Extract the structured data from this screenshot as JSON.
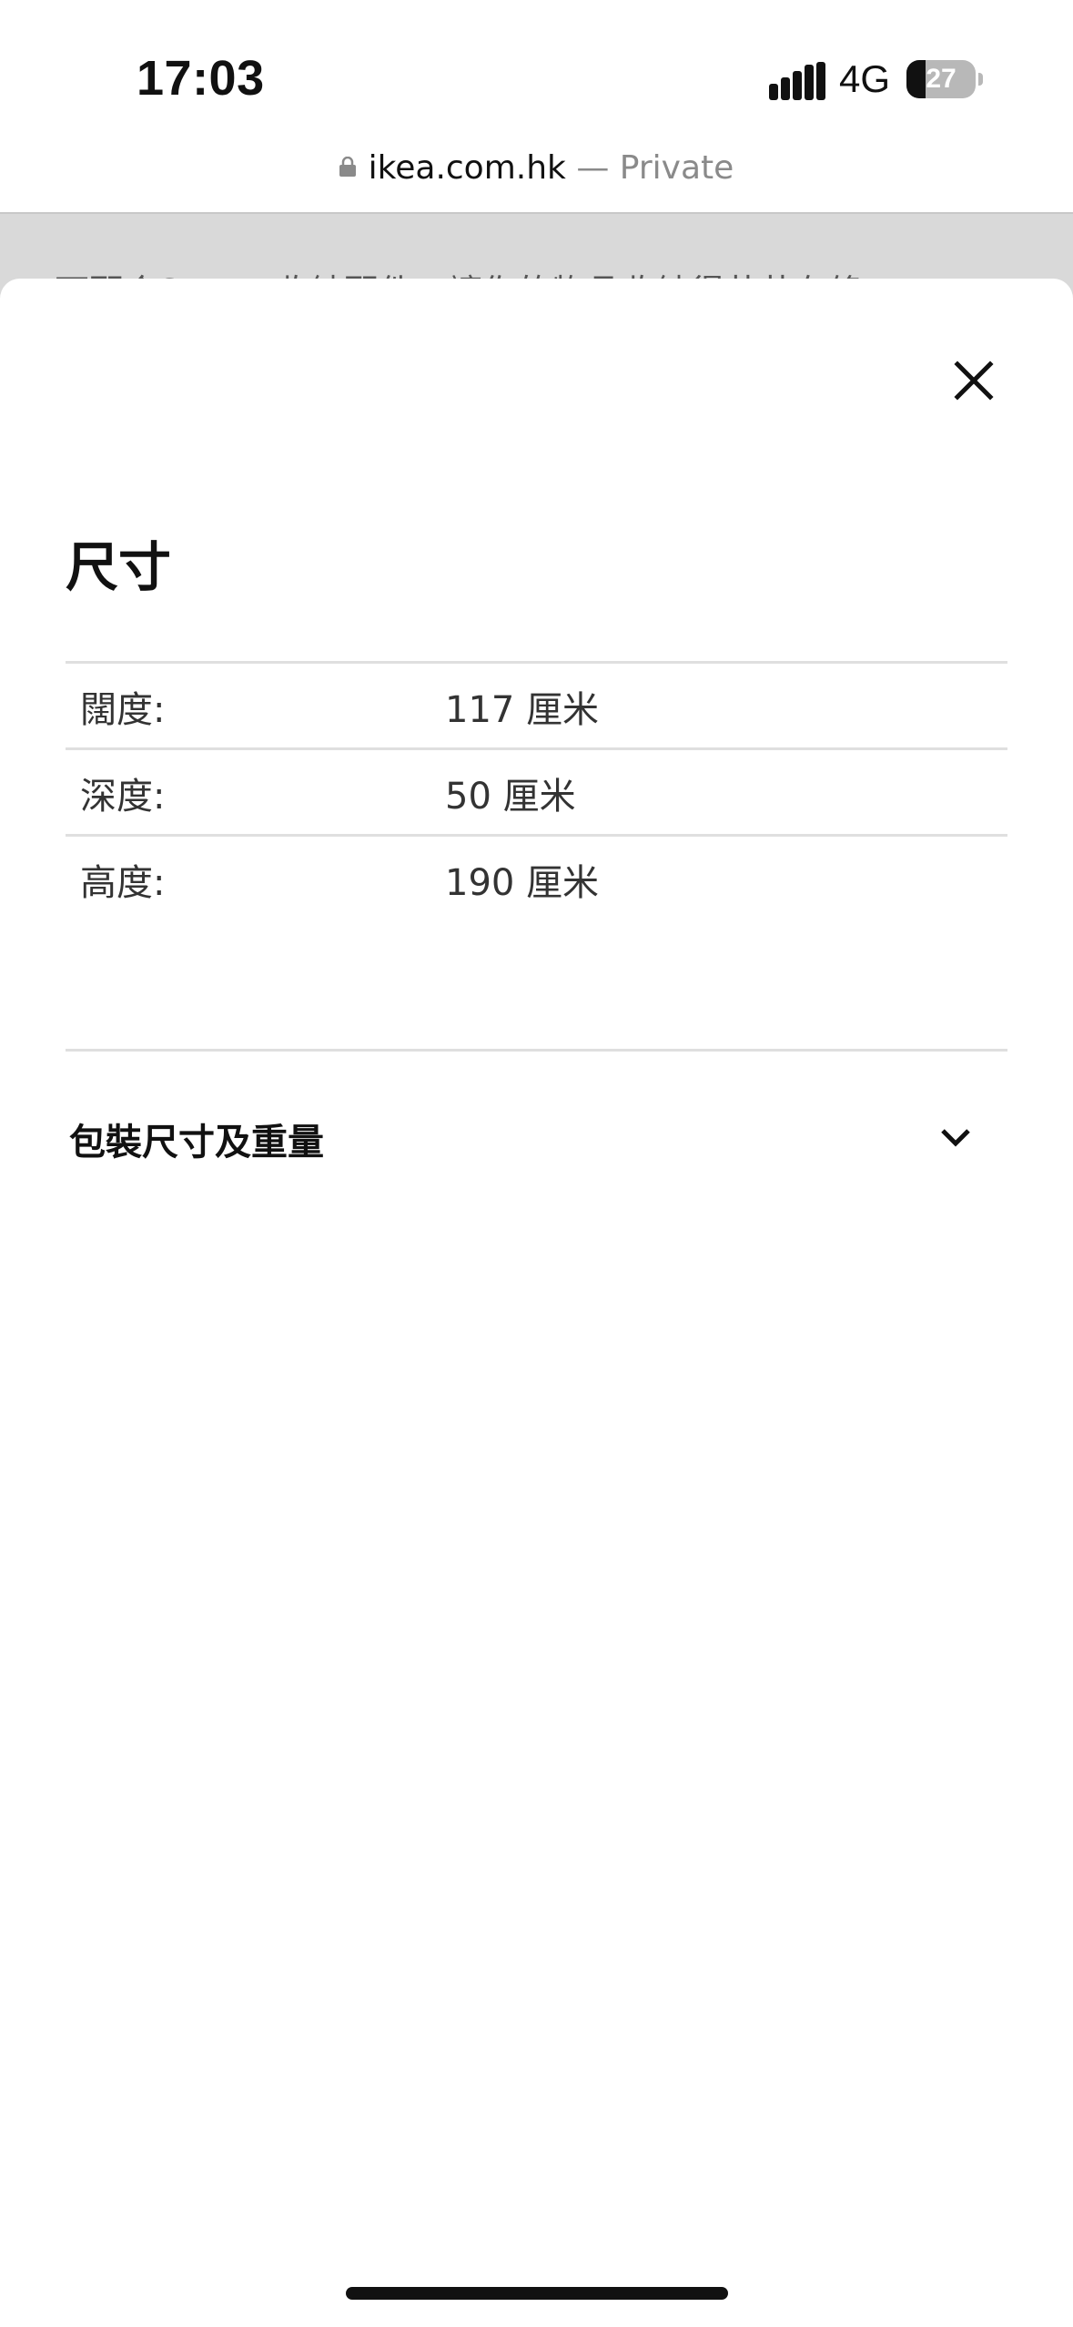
{
  "status_bar": {
    "time": "17:03",
    "network": "4G",
    "battery_level": "27",
    "battery_fraction": 0.27
  },
  "url_bar": {
    "domain": "ikea.com.hk",
    "separator": "—",
    "mode": "Private",
    "lock_icon": "lock-icon"
  },
  "background_page": {
    "text": "可配合SKUBB收納配件，讓你的物品收納得井井有條"
  },
  "sheet": {
    "close_icon": "close-icon",
    "title": "尺寸",
    "dimensions": [
      {
        "label": "闊度:",
        "value": "117 厘米"
      },
      {
        "label": "深度:",
        "value": "50 厘米"
      },
      {
        "label": "高度:",
        "value": "190 厘米"
      }
    ],
    "accordion": {
      "label": "包裝尺寸及重量",
      "icon": "chevron-down-icon",
      "expanded": false
    }
  }
}
